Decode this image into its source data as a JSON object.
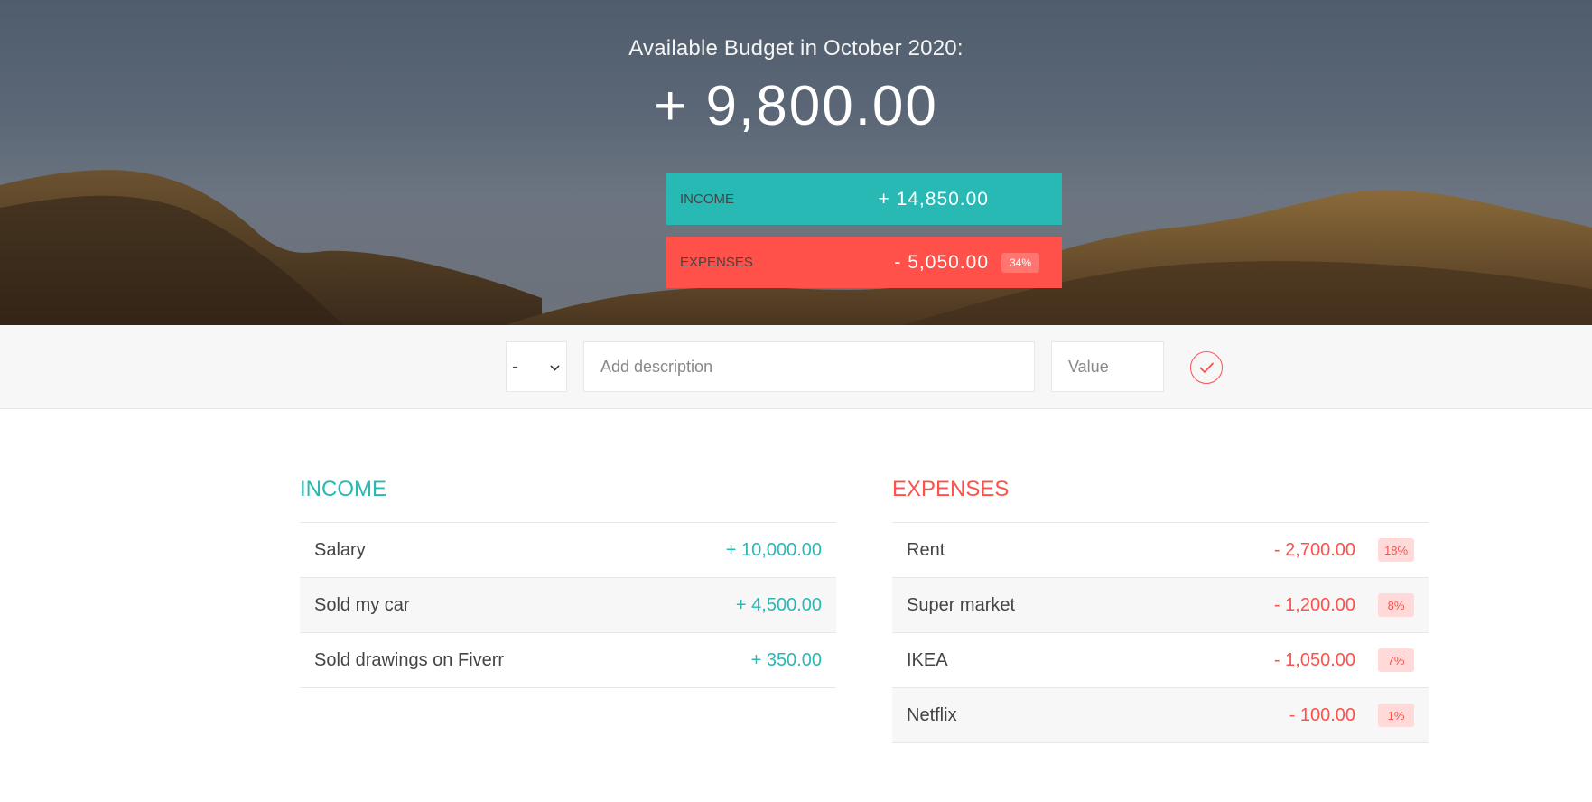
{
  "budget": {
    "title": "Available Budget in October 2020:",
    "value": "+ 9,800.00"
  },
  "summary": {
    "income": {
      "label": "Income",
      "value": "+ 14,850.00",
      "color": "#28b9b5"
    },
    "expenses": {
      "label": "Expenses",
      "value": "- 5,050.00",
      "percentage": "34%",
      "color": "#ff5049"
    }
  },
  "add": {
    "type_value": "-",
    "description_placeholder": "Add description",
    "value_placeholder": "Value",
    "submit_icon": "checkmark-circle-icon"
  },
  "income": {
    "title": "Income",
    "items": [
      {
        "description": "Salary",
        "value": "+ 10,000.00"
      },
      {
        "description": "Sold my car",
        "value": "+ 4,500.00"
      },
      {
        "description": "Sold drawings on Fiverr",
        "value": "+ 350.00"
      }
    ]
  },
  "expenses": {
    "title": "Expenses",
    "items": [
      {
        "description": "Rent",
        "value": "- 2,700.00",
        "percentage": "18%"
      },
      {
        "description": "Super market",
        "value": "- 1,200.00",
        "percentage": "8%"
      },
      {
        "description": "IKEA",
        "value": "- 1,050.00",
        "percentage": "7%"
      },
      {
        "description": "Netflix",
        "value": "- 100.00",
        "percentage": "1%"
      }
    ]
  }
}
